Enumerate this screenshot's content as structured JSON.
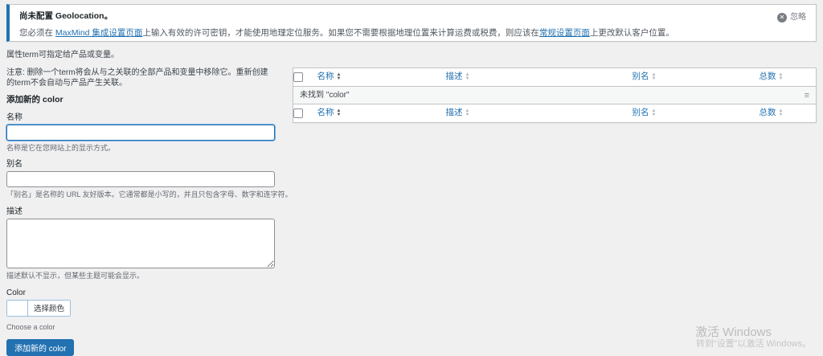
{
  "colors": {
    "accent": "#2271b1",
    "page_background": "#f0f0f1",
    "notice_border_left": "#2271b1",
    "link": "#2271b1",
    "empty_row_background": "#f6f7f7"
  },
  "icons": {
    "dismiss": "✕",
    "sort_asc": "▲",
    "sort_desc": "▼",
    "drag_handle": "≡"
  },
  "notice": {
    "title": "尚未配置 Geolocation。",
    "body_part1": "您必须在 ",
    "link1": "MaxMind 集成设置页面",
    "body_part2": "上输入有效的许可密钥，才能使用地理定位服务。如果您不需要根据地理位置来计算运费或税费，则应该在",
    "link2": "常规设置页面",
    "body_part3": "上更改默认客户位置。",
    "dismiss_label": "忽略"
  },
  "form": {
    "intro": "属性term可指定给产品或变量。",
    "note": "注意: 删除一个term将会从与之关联的全部产品和变量中移除它。重新创建的term不会自动与产品产生关联。",
    "heading": "添加新的 color",
    "name": {
      "label": "名称",
      "value": "",
      "hint": "名称是它在您网站上的显示方式。"
    },
    "slug": {
      "label": "别名",
      "value": "",
      "hint": "「别名」是名称的 URL 友好版本。它通常都是小写的，并且只包含字母、数字和连字符。"
    },
    "description": {
      "label": "描述",
      "value": "",
      "hint": "描述默认不显示，但某些主题可能会显示。"
    },
    "color": {
      "label": "Color",
      "picker_label": "选择颜色",
      "hint": "Choose a color"
    },
    "submit_label": "添加新的 color"
  },
  "table": {
    "columns": [
      {
        "label": "名称",
        "sorted": true
      },
      {
        "label": "描述",
        "sorted": false
      },
      {
        "label": "别名",
        "sorted": false
      },
      {
        "label": "总数",
        "sorted": false
      }
    ],
    "empty_message": "未找到 \"color\""
  },
  "watermark": {
    "line1": "激活 Windows",
    "line2": "转到“设置”以激活 Windows。"
  }
}
